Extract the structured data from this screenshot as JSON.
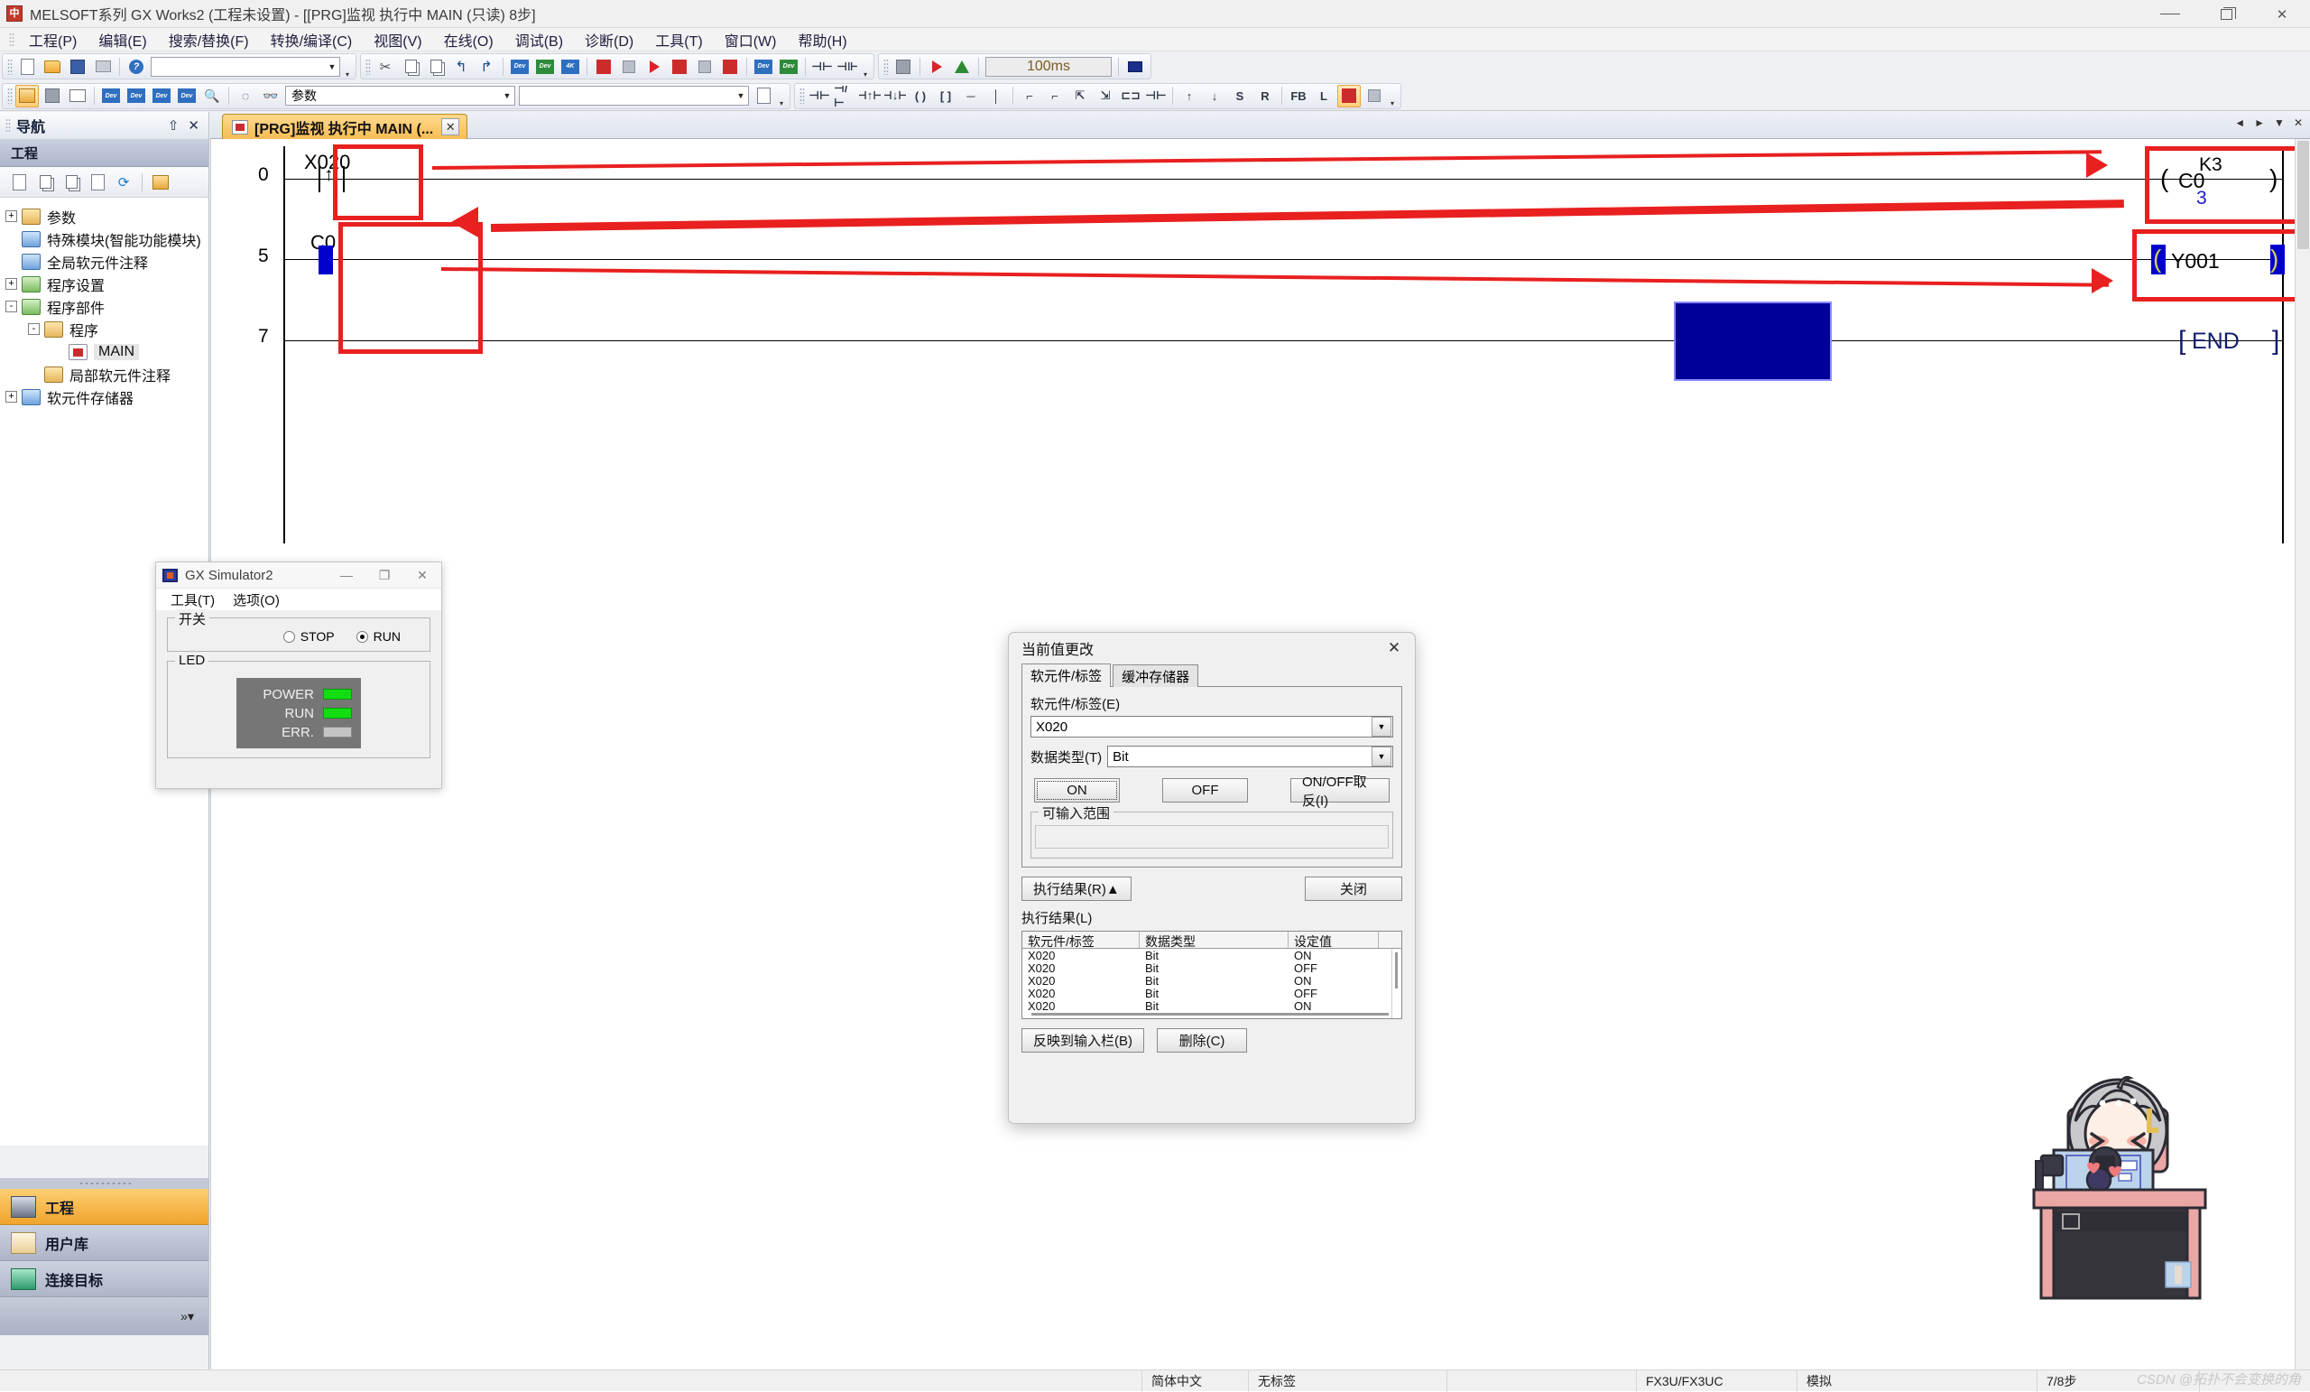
{
  "window": {
    "title": "MELSOFT系列 GX Works2 (工程未设置) - [[PRG]监视 执行中 MAIN (只读) 8步]",
    "app_icon": "melsoft-icon",
    "minimize": "—",
    "restore": "❐",
    "close": "✕"
  },
  "menubar": {
    "items": [
      {
        "label": "工程(P)"
      },
      {
        "label": "编辑(E)"
      },
      {
        "label": "搜索/替换(F)"
      },
      {
        "label": "转换/编译(C)"
      },
      {
        "label": "视图(V)"
      },
      {
        "label": "在线(O)"
      },
      {
        "label": "调试(B)"
      },
      {
        "label": "诊断(D)"
      },
      {
        "label": "工具(T)"
      },
      {
        "label": "窗口(W)"
      },
      {
        "label": "帮助(H)"
      }
    ]
  },
  "toolbar": {
    "scan_time_value": "100ms",
    "param_combo_value": "参数",
    "param_combo_arrow": "▼",
    "second_combo_value": "",
    "icons": [
      "new-project-icon",
      "open-project-icon",
      "save-icon",
      "print-icon",
      "help-icon",
      "cut-icon",
      "copy-icon",
      "paste-icon",
      "undo-icon",
      "redo-icon",
      "find-device-icon",
      "find-instruction-icon",
      "find-contact-icon",
      "step-forward-icon",
      "step-back-icon",
      "monitor-start-icon",
      "monitor-stop-icon",
      "write-to-plc-icon",
      "read-from-plc-icon",
      "device-test-icon",
      "device-batch-icon",
      "simulation-icon",
      "run-icon",
      "pause-icon",
      "remote-operation-icon",
      "project-tree-icon",
      "device-memory-icon",
      "docking-window-icon",
      "device-find-icon",
      "device-list-icon",
      "device-watch-icon",
      "device-monitor-icon",
      "zoom-icon",
      "binoculars-icon"
    ]
  },
  "navigation": {
    "title": "导航",
    "pin_icon": "pin-icon",
    "close_icon": "close-icon",
    "section": "工程",
    "toolbar_icons": [
      "new-data-icon",
      "copy-data-icon",
      "paste-data-icon",
      "data-property-icon",
      "refresh-icon",
      "view-mode-icon"
    ],
    "tree": [
      {
        "label": "参数",
        "expander": "+",
        "depth": 0,
        "icon": "parameter-icon"
      },
      {
        "label": "特殊模块(智能功能模块)",
        "expander": "",
        "depth": 0,
        "icon": "special-module-icon"
      },
      {
        "label": "全局软元件注释",
        "expander": "",
        "depth": 0,
        "icon": "global-comment-icon"
      },
      {
        "label": "程序设置",
        "expander": "+",
        "depth": 0,
        "icon": "program-setting-icon"
      },
      {
        "label": "程序部件",
        "expander": "-",
        "depth": 0,
        "icon": "pou-icon"
      },
      {
        "label": "程序",
        "expander": "-",
        "depth": 1,
        "icon": "program-folder-icon"
      },
      {
        "label": "MAIN",
        "expander": "",
        "depth": 2,
        "icon": "ladder-program-icon",
        "selected": true
      },
      {
        "label": "局部软元件注释",
        "expander": "",
        "depth": 1,
        "icon": "local-comment-icon"
      },
      {
        "label": "软元件存储器",
        "expander": "+",
        "depth": 0,
        "icon": "device-memory-icon"
      }
    ],
    "buttons": [
      {
        "label": "工程",
        "icon": "project-icon",
        "active": true
      },
      {
        "label": "用户库",
        "icon": "user-library-icon",
        "active": false
      },
      {
        "label": "连接目标",
        "icon": "connection-destination-icon",
        "active": false
      }
    ],
    "more_icon": "chevrons-right-icon"
  },
  "workspace": {
    "tab": {
      "label": "[PRG]监视 执行中 MAIN (...",
      "icon": "ladder-doc-icon",
      "close": "✕"
    },
    "tab_nav": [
      "◄",
      "►",
      "▼",
      "✕"
    ]
  },
  "ladder": {
    "steps": [
      "0",
      "5",
      "7"
    ],
    "rungs": [
      {
        "step": "0",
        "contact": "X020",
        "contact_type": "rising-edge",
        "coil": "C0",
        "preset": "K3",
        "current_value": "3"
      },
      {
        "step": "5",
        "contact": "C0",
        "contact_type": "normally-open-on",
        "coil": "Y001",
        "coil_state": "on"
      },
      {
        "step": "7",
        "instruction": "END"
      }
    ],
    "annotations": {
      "red_boxes": 4,
      "red_arrows": 3
    }
  },
  "gx_simulator": {
    "title": "GX Simulator2",
    "icon": "simulator-icon",
    "window_buttons": {
      "minimize": "—",
      "maximize": "❐",
      "close": "✕"
    },
    "menu": [
      {
        "label": "工具(T)"
      },
      {
        "label": "选项(O)"
      }
    ],
    "switch_group": "开关",
    "switch_options": [
      {
        "label": "STOP",
        "selected": false
      },
      {
        "label": "RUN",
        "selected": true
      }
    ],
    "led_group": "LED",
    "leds": [
      {
        "label": "POWER",
        "state": "on",
        "color": "#11dd11"
      },
      {
        "label": "RUN",
        "state": "on",
        "color": "#11dd11"
      },
      {
        "label": "ERR.",
        "state": "off",
        "color": "#c4c4c4"
      }
    ]
  },
  "value_dialog": {
    "title": "当前值更改",
    "close": "✕",
    "tabs": [
      {
        "label": "软元件/标签",
        "active": true
      },
      {
        "label": "缓冲存储器",
        "active": false
      }
    ],
    "device_label": "软元件/标签(E)",
    "device_value": "X020",
    "datatype_label": "数据类型(T)",
    "datatype_value": "Bit",
    "combo_arrow": "▼",
    "buttons": {
      "on": "ON",
      "off": "OFF",
      "toggle": "ON/OFF取反(I)"
    },
    "range_group": "可输入范围",
    "range_text": "",
    "result_toggle": "执行结果(R)▲",
    "close_button": "关闭",
    "result_label": "执行结果(L)",
    "result_columns": [
      "软元件/标签",
      "数据类型",
      "设定值"
    ],
    "result_rows": [
      {
        "device": "X020",
        "datatype": "Bit",
        "value": "ON"
      },
      {
        "device": "X020",
        "datatype": "Bit",
        "value": "OFF"
      },
      {
        "device": "X020",
        "datatype": "Bit",
        "value": "ON"
      },
      {
        "device": "X020",
        "datatype": "Bit",
        "value": "OFF"
      },
      {
        "device": "X020",
        "datatype": "Bit",
        "value": "ON"
      }
    ],
    "reflect_button": "反映到输入栏(B)",
    "delete_button": "删除(C)"
  },
  "statusbar": {
    "language": "简体中文",
    "label": "无标签",
    "blank": "",
    "plc_type": "FX3U/FX3UC",
    "mode": "模拟",
    "steps": "7/8步"
  },
  "watermark": "CSDN @拓扑不会变换的角",
  "mascot": "anime-girl-at-desk-sticker"
}
